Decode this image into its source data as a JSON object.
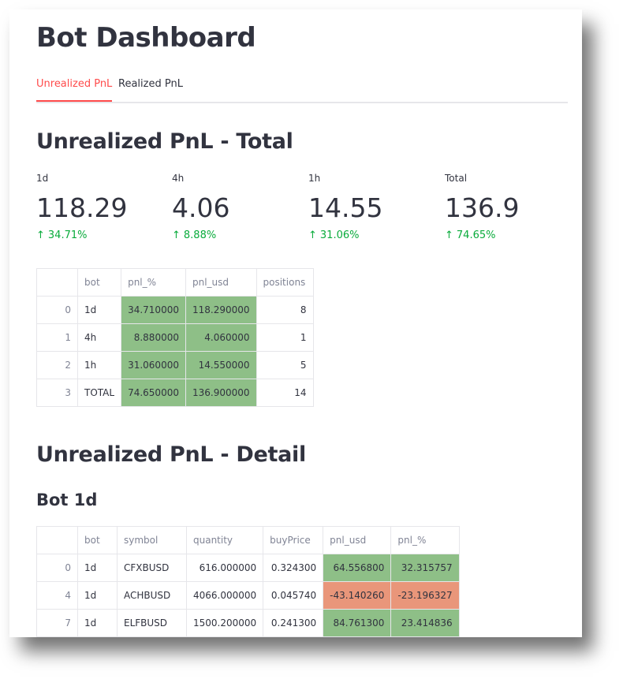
{
  "page": {
    "title": "Bot Dashboard"
  },
  "tabs": [
    {
      "label": "Unrealized PnL",
      "active": true
    },
    {
      "label": "Realized PnL",
      "active": false
    }
  ],
  "total_section": {
    "heading": "Unrealized PnL - Total",
    "metrics": [
      {
        "label": "1d",
        "value": "118.29",
        "delta": "34.71%"
      },
      {
        "label": "4h",
        "value": "4.06",
        "delta": "8.88%"
      },
      {
        "label": "1h",
        "value": "14.55",
        "delta": "31.06%"
      },
      {
        "label": "Total",
        "value": "136.9",
        "delta": "74.65%"
      }
    ],
    "table": {
      "columns": [
        "",
        "bot",
        "pnl_%",
        "pnl_usd",
        "positions"
      ],
      "rows": [
        [
          "0",
          "1d",
          "34.710000",
          "118.290000",
          "8"
        ],
        [
          "1",
          "4h",
          "8.880000",
          "4.060000",
          "1"
        ],
        [
          "2",
          "1h",
          "31.060000",
          "14.550000",
          "5"
        ],
        [
          "3",
          "TOTAL",
          "74.650000",
          "136.900000",
          "14"
        ]
      ]
    }
  },
  "detail_section": {
    "heading": "Unrealized PnL - Detail",
    "subheading": "Bot 1d",
    "table": {
      "columns": [
        "",
        "bot",
        "symbol",
        "quantity",
        "buyPrice",
        "pnl_usd",
        "pnl_%"
      ],
      "rows": [
        [
          "0",
          "1d",
          "CFXBUSD",
          "616.000000",
          "0.324300",
          "64.556800",
          "32.315757"
        ],
        [
          "4",
          "1d",
          "ACHBUSD",
          "4066.000000",
          "0.045740",
          "-43.140260",
          "-23.196327"
        ],
        [
          "7",
          "1d",
          "ELFBUSD",
          "1500.200000",
          "0.241300",
          "84.761300",
          "23.414836"
        ]
      ]
    }
  },
  "colors": {
    "accent": "#ff4b4b",
    "positive": "#8ebf87",
    "negative": "#e9967a",
    "delta": "#09ab3b"
  }
}
